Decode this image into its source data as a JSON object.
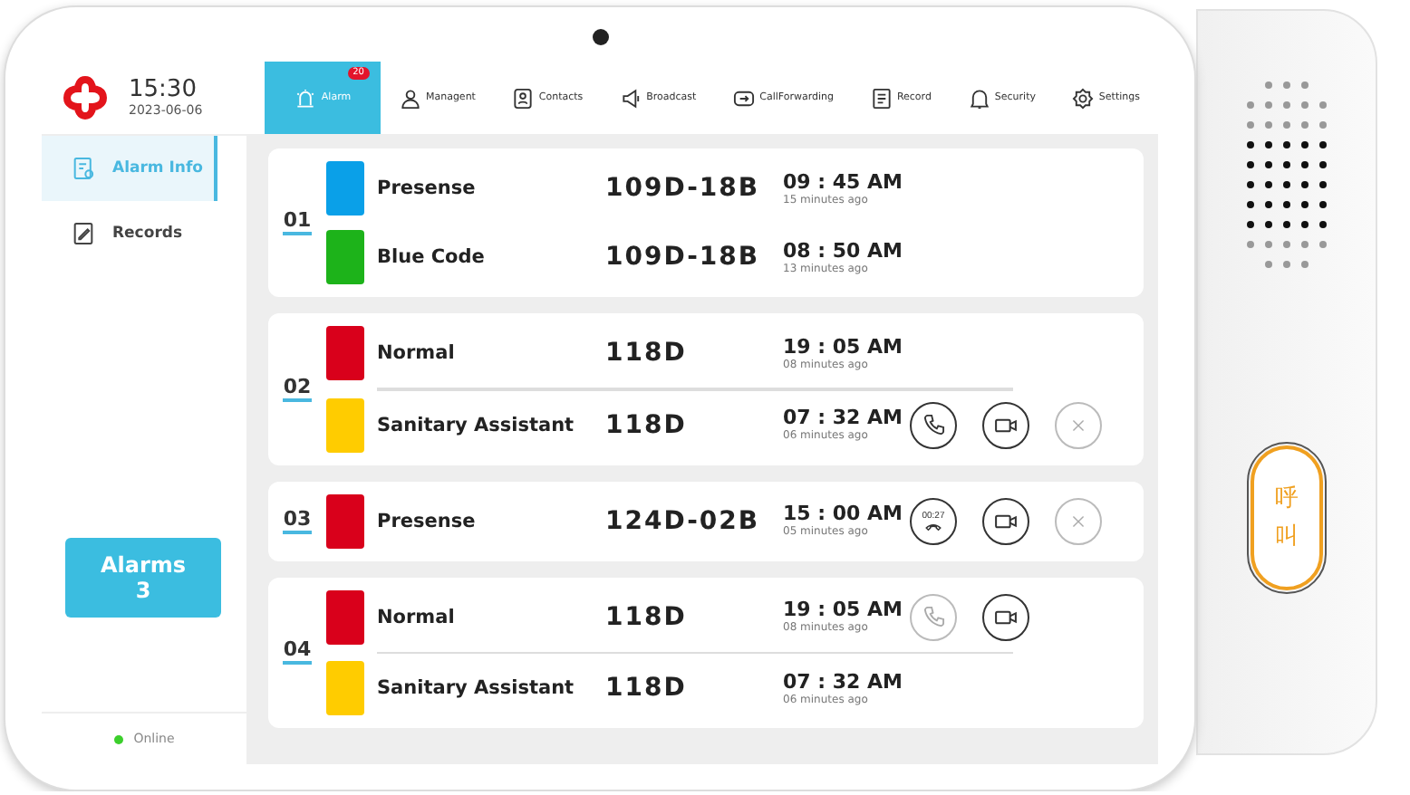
{
  "header": {
    "time": "15:30",
    "date": "2023-06-06"
  },
  "tabs": [
    {
      "label": "Alarm",
      "selected": true,
      "badge": "20"
    },
    {
      "label": "Managent",
      "selected": false
    },
    {
      "label": "Contacts",
      "selected": false
    },
    {
      "label": "Broadcast",
      "selected": false
    },
    {
      "label": "CallForwarding",
      "selected": false
    },
    {
      "label": "Record",
      "selected": false
    },
    {
      "label": "Security",
      "selected": false
    },
    {
      "label": "Settings",
      "selected": false
    }
  ],
  "sidebar": {
    "items": [
      {
        "label": "Alarm Info",
        "selected": true
      },
      {
        "label": "Records",
        "selected": false
      }
    ],
    "alarms_button": {
      "label": "Alarms",
      "count": "3"
    },
    "status": {
      "label": "Online",
      "online": true
    }
  },
  "alarm_groups": [
    {
      "number": "01",
      "alarms": [
        {
          "type": "Presense",
          "color": "#0aa0e8",
          "room": "109D-18B",
          "time": "09 : 45 AM",
          "ago": "15 minutes ago"
        },
        {
          "type": "Blue Code",
          "color": "#1db31a",
          "room": "109D-18B",
          "time": "08 : 50 AM",
          "ago": "13 minutes ago"
        }
      ]
    },
    {
      "number": "02",
      "divider": true,
      "alarms": [
        {
          "type": "Normal",
          "color": "#d9001b",
          "room": "118D",
          "time": "19 : 05 AM",
          "ago": "08 minutes ago"
        },
        {
          "type": "Sanitary Assistant",
          "color": "#ffcc00",
          "room": "118D",
          "time": "07 : 32 AM",
          "ago": "06 minutes ago",
          "actions": [
            {
              "kind": "call",
              "disabled": false
            },
            {
              "kind": "video",
              "disabled": false
            },
            {
              "kind": "dismiss",
              "disabled": true
            }
          ]
        }
      ]
    },
    {
      "number": "03",
      "alarms": [
        {
          "type": "Presense",
          "color": "#d9001b",
          "room": "124D-02B",
          "time": "15 : 00 AM",
          "ago": "05 minutes ago",
          "actions": [
            {
              "kind": "timer",
              "label": "00:27",
              "disabled": false
            },
            {
              "kind": "video",
              "disabled": false
            },
            {
              "kind": "dismiss",
              "disabled": true
            }
          ]
        }
      ]
    },
    {
      "number": "04",
      "divider": true,
      "alarms": [
        {
          "type": "Normal",
          "color": "#d9001b",
          "room": "118D",
          "time": "19 : 05 AM",
          "ago": "08 minutes ago",
          "actions": [
            {
              "kind": "call",
              "disabled": true
            },
            {
              "kind": "video",
              "disabled": false
            }
          ]
        },
        {
          "type": "Sanitary Assistant",
          "color": "#ffcc00",
          "room": "118D",
          "time": "07 : 32 AM",
          "ago": "06 minutes ago"
        }
      ]
    }
  ],
  "device": {
    "call_button": {
      "label": "呼叫"
    }
  }
}
